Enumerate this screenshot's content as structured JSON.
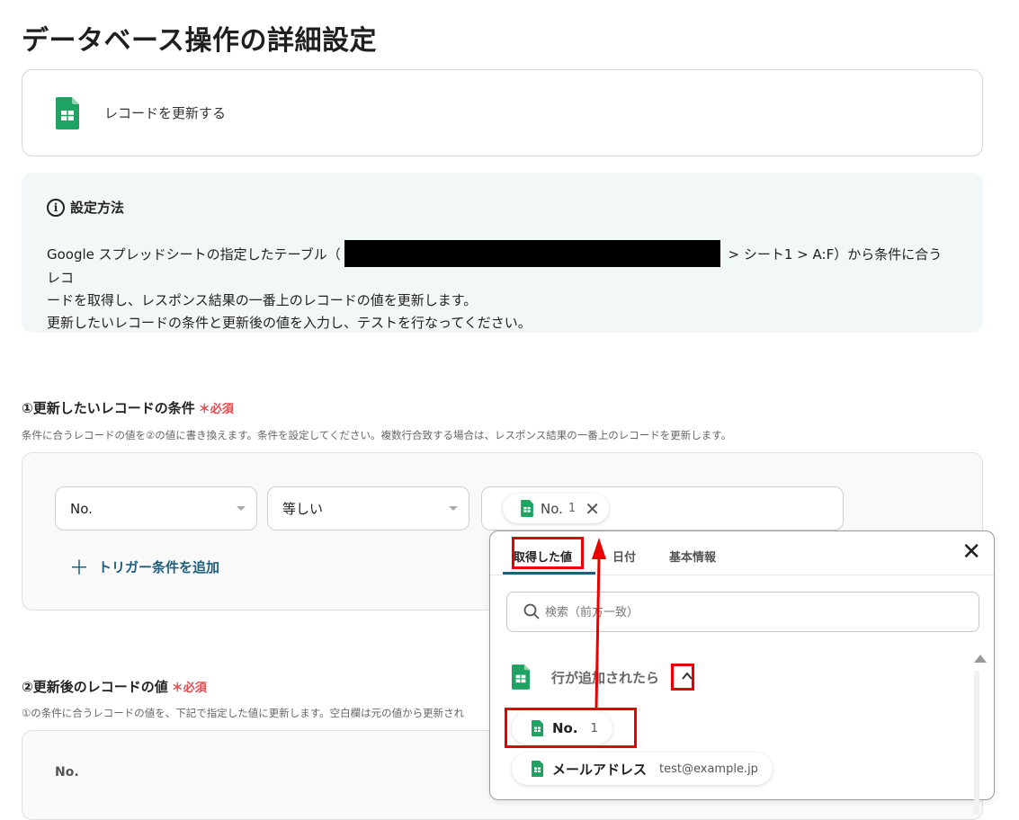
{
  "page": {
    "title": "データベース操作の詳細設定"
  },
  "action": {
    "label": "レコードを更新する",
    "icon": "google-sheets-icon",
    "icon_color": "#1ea362"
  },
  "info": {
    "icon": "info-icon",
    "title": "設定方法",
    "line1_before": "Google スプレッドシートの指定したテーブル（",
    "line1_after": " > シート1 > A:F）から条件に合うレコ",
    "line2": "ードを取得し、レスポンス結果の一番上のレコードの値を更新します。",
    "line3": "更新したいレコードの条件と更新後の値を入力し、テストを行なってください。"
  },
  "section1": {
    "title": "①更新したいレコードの条件",
    "required": "＊必須",
    "desc": "条件に合うレコードの値を②の値に書き換えます。条件を設定してください。複数行合致する場合は、レスポンス結果の一番上のレコードを更新します。",
    "field_select": "No.",
    "operator_select": "等しい",
    "value_chip": {
      "label": "No.",
      "sub": "1"
    },
    "add_trigger": "トリガー条件を追加"
  },
  "section2": {
    "title": "②更新後のレコードの値",
    "required": "＊必須",
    "desc": "①の条件に合うレコードの値を、下記で指定した値に更新します。空白欄は元の値から更新され",
    "first_field_label": "No."
  },
  "dropdown": {
    "tabs": [
      "取得した値",
      "日付",
      "基本情報"
    ],
    "search_placeholder": "検索（前方一致）",
    "group_label": "行が追加されたら",
    "items": [
      {
        "name": "No.",
        "value": "1"
      },
      {
        "name": "メールアドレス",
        "value": "test@example.jp"
      }
    ]
  },
  "colors": {
    "highlight": "#e60000",
    "accent": "#1d5f7a",
    "required": "#e5484d",
    "info_bg": "#f1f8f7"
  }
}
